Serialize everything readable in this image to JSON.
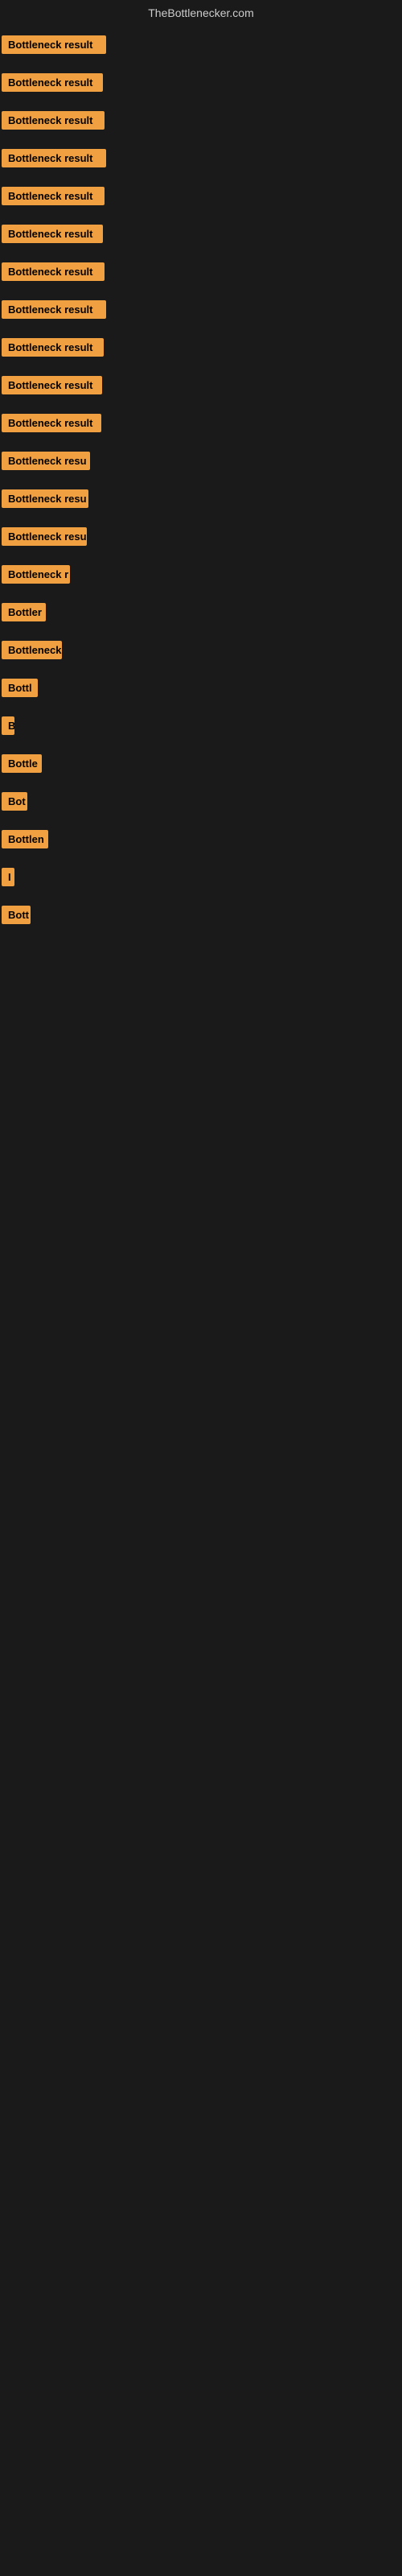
{
  "header": {
    "title": "TheBottlenecker.com"
  },
  "labels": [
    {
      "text": "Bottleneck result",
      "width": 130
    },
    {
      "text": "Bottleneck result",
      "width": 126
    },
    {
      "text": "Bottleneck result",
      "width": 128
    },
    {
      "text": "Bottleneck result",
      "width": 130
    },
    {
      "text": "Bottleneck result",
      "width": 128
    },
    {
      "text": "Bottleneck result",
      "width": 126
    },
    {
      "text": "Bottleneck result",
      "width": 128
    },
    {
      "text": "Bottleneck result",
      "width": 130
    },
    {
      "text": "Bottleneck result",
      "width": 127
    },
    {
      "text": "Bottleneck result",
      "width": 125
    },
    {
      "text": "Bottleneck result",
      "width": 124
    },
    {
      "text": "Bottleneck resu",
      "width": 110
    },
    {
      "text": "Bottleneck resu",
      "width": 108
    },
    {
      "text": "Bottleneck resu",
      "width": 106
    },
    {
      "text": "Bottleneck r",
      "width": 85
    },
    {
      "text": "Bottler",
      "width": 55
    },
    {
      "text": "Bottleneck",
      "width": 75
    },
    {
      "text": "Bottl",
      "width": 45
    },
    {
      "text": "B",
      "width": 12
    },
    {
      "text": "Bottle",
      "width": 50
    },
    {
      "text": "Bot",
      "width": 32
    },
    {
      "text": "Bottlen",
      "width": 58
    },
    {
      "text": "I",
      "width": 8
    },
    {
      "text": "Bott",
      "width": 36
    }
  ]
}
